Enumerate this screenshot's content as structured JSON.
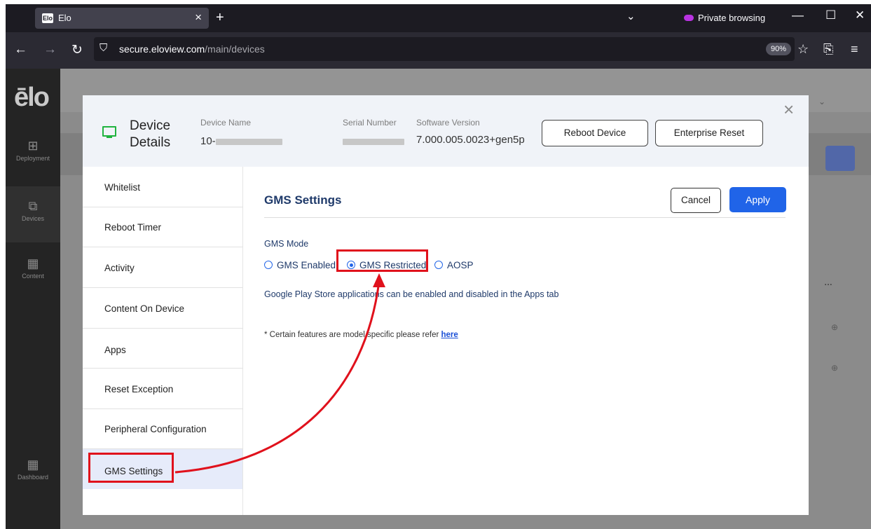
{
  "browser": {
    "tab_title": "Elo",
    "tab_favicon_text": "Elo",
    "tab_close": "×",
    "new_tab": "+",
    "tab_list": "⌄",
    "private_label": "Private browsing",
    "url_host": "secure.eloview.com",
    "url_path": "/main/devices",
    "zoom_level": "90%"
  },
  "app": {
    "logo": "ēlo",
    "nav": [
      {
        "label": "Deployment"
      },
      {
        "label": "Devices"
      },
      {
        "label": "Content"
      },
      {
        "label": "Dashboard"
      }
    ]
  },
  "modal": {
    "header": {
      "title_line1": "Device",
      "title_line2": "Details",
      "device_name_label": "Device Name",
      "device_name_prefix": "10-",
      "serial_number_label": "Serial Number",
      "software_version_label": "Software Version",
      "software_version": "7.000.005.0023+gen5p",
      "reboot_button": "Reboot Device",
      "enterprise_reset_button": "Enterprise Reset",
      "close": "×"
    },
    "sidebar": [
      {
        "label": "Whitelist"
      },
      {
        "label": "Reboot Timer"
      },
      {
        "label": "Activity"
      },
      {
        "label": "Content On Device"
      },
      {
        "label": "Apps"
      },
      {
        "label": "Reset Exception"
      },
      {
        "label": "Peripheral Configuration"
      },
      {
        "label": "GMS Settings",
        "active": true
      }
    ],
    "content": {
      "title": "GMS Settings",
      "cancel_button": "Cancel",
      "apply_button": "Apply",
      "mode_label": "GMS Mode",
      "options": [
        {
          "label": "GMS Enabled",
          "checked": false
        },
        {
          "label": "GMS Restricted",
          "checked": true
        },
        {
          "label": "AOSP",
          "checked": false
        }
      ],
      "info_text": "Google Play Store applications can be enabled and disabled in the Apps tab",
      "note_text": "* Certain features are model specific please refer",
      "note_link": "here"
    }
  },
  "colors": {
    "accent": "#2064e8",
    "annotation": "#e0111c",
    "status_icon": "#20b33f"
  }
}
